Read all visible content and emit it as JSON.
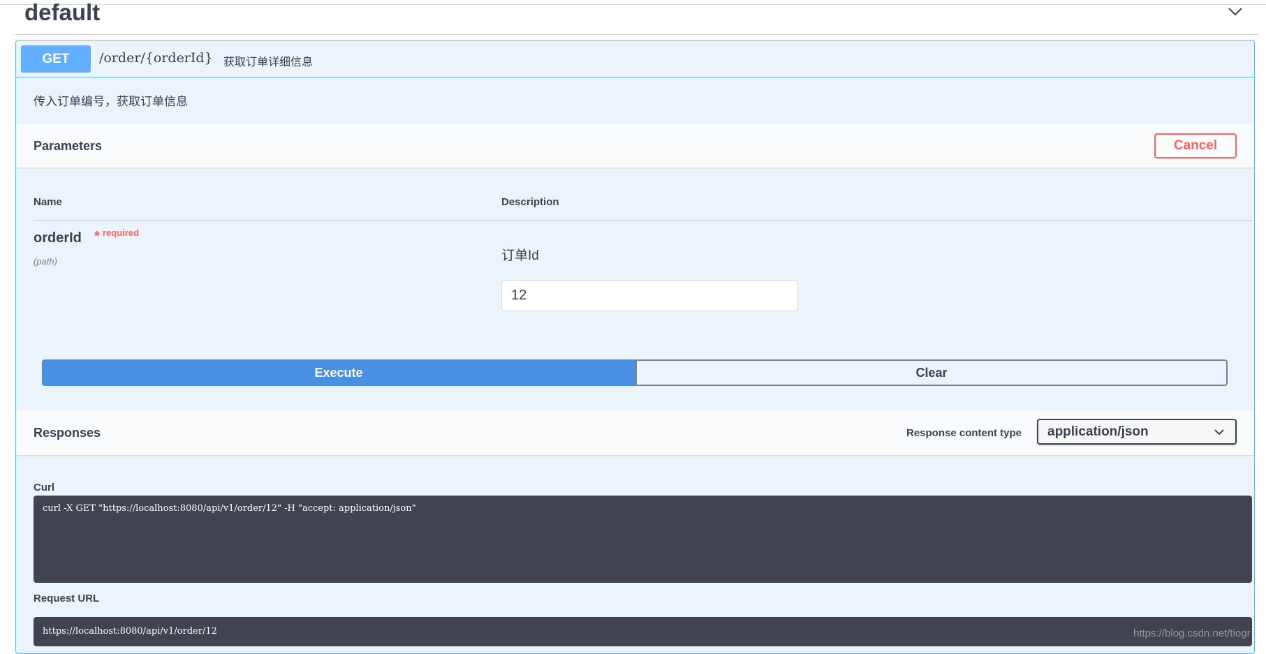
{
  "section": {
    "title": "default"
  },
  "operation": {
    "method": "GET",
    "path": "/order/{orderId}",
    "summary": "获取订单详细信息",
    "description": "传入订单编号，获取订单信息"
  },
  "parameters": {
    "title": "Parameters",
    "cancel_label": "Cancel",
    "col_name": "Name",
    "col_description": "Description",
    "items": [
      {
        "name": "orderId",
        "required_star": "*",
        "required_label": "required",
        "in": "(path)",
        "description": "订单Id",
        "value": "12"
      }
    ]
  },
  "actions": {
    "execute_label": "Execute",
    "clear_label": "Clear"
  },
  "responses": {
    "title": "Responses",
    "content_type_label": "Response content type",
    "content_type_value": "application/json",
    "curl_label": "Curl",
    "curl_command": "curl -X GET \"https://localhost:8080/api/v1/order/12\" -H \"accept: application/json\"",
    "request_url_label": "Request URL",
    "request_url": "https://localhost:8080/api/v1/order/12"
  },
  "watermark": "https://blog.csdn.net/tiogr",
  "colors": {
    "get_method": "#61affe",
    "opblock_bg": "#ebf3fb",
    "execute": "#4990e2",
    "cancel": "#ff6060",
    "code_bg": "#41444e"
  },
  "icons": {
    "section_toggle": "chevron-down-icon",
    "select_toggle": "chevron-down-icon"
  }
}
